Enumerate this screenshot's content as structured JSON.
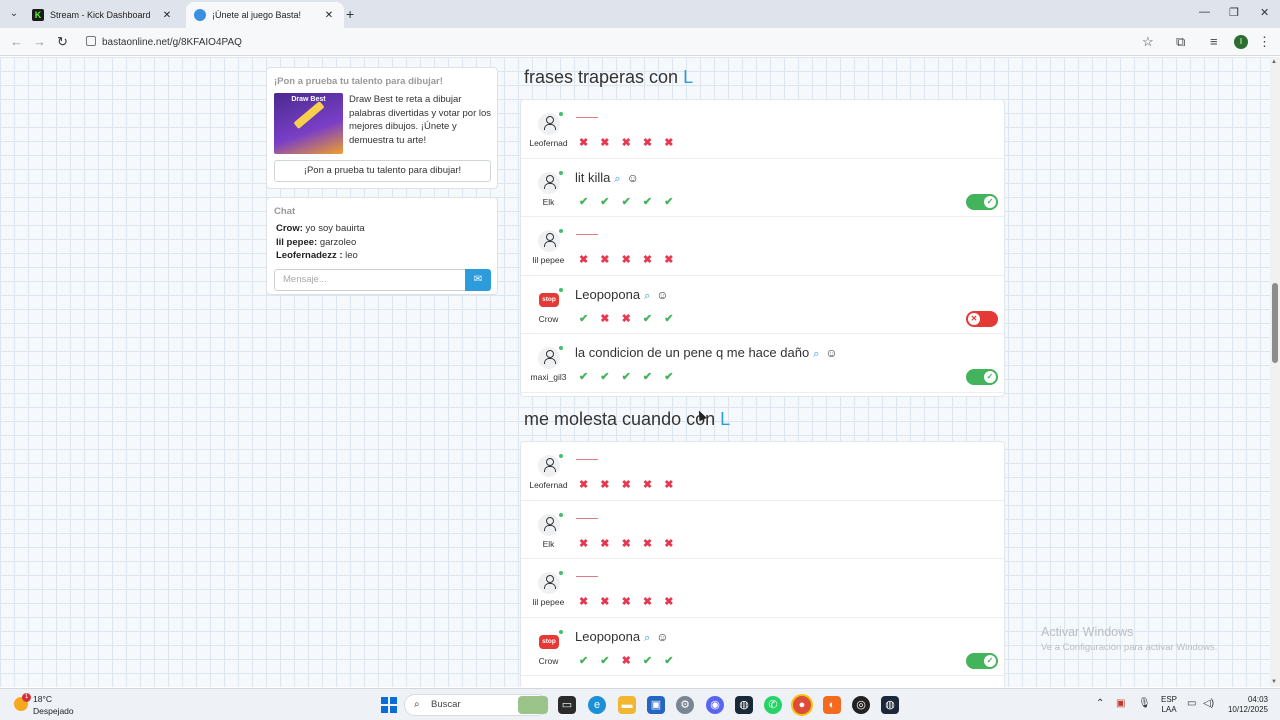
{
  "browser": {
    "tabs": [
      {
        "title": "Stream - Kick Dashboard",
        "active": false
      },
      {
        "title": "¡Únete al juego Basta!",
        "active": true
      }
    ],
    "url": "bastaonline.net/g/8KFAIO4PAQ",
    "profile_initial": "I"
  },
  "promo": {
    "heading": "¡Pon a prueba tu talento para dibujar!",
    "image_brand": "Draw Best",
    "text": "Draw Best te reta a dibujar palabras divertidas y votar por los mejores dibujos. ¡Únete y demuestra tu arte!",
    "button": "¡Pon a prueba tu talento para dibujar!"
  },
  "chat": {
    "heading": "Chat",
    "messages": [
      {
        "user": "Crow:",
        "text": " yo soy bauirta"
      },
      {
        "user": "lil pepee:",
        "text": " garzoleo"
      },
      {
        "user": "Leofernadezz :",
        "text": " leo"
      }
    ],
    "placeholder": "Mensaje..."
  },
  "categories": [
    {
      "title": "frases traperas con",
      "letter": "L",
      "rows": [
        {
          "user": "Leofernad",
          "avatar": "person",
          "answer": "",
          "votes": [
            "no",
            "no",
            "no",
            "no",
            "no"
          ],
          "toggle": null
        },
        {
          "user": "Elk",
          "avatar": "person",
          "answer": "lit killa",
          "votes": [
            "yes",
            "yes",
            "yes",
            "yes",
            "yes"
          ],
          "toggle": "on"
        },
        {
          "user": "lil pepee",
          "avatar": "person",
          "answer": "",
          "votes": [
            "no",
            "no",
            "no",
            "no",
            "no"
          ],
          "toggle": null
        },
        {
          "user": "Crow",
          "avatar": "stop",
          "answer": "Leopopona",
          "votes": [
            "yes",
            "no",
            "no",
            "yes",
            "yes"
          ],
          "toggle": "off"
        },
        {
          "user": "maxi_gil3",
          "avatar": "person",
          "answer": "la condicion de un pene q me hace daño",
          "votes": [
            "yes",
            "yes",
            "yes",
            "yes",
            "yes"
          ],
          "toggle": "on"
        }
      ]
    },
    {
      "title": "me molesta cuando con",
      "letter": "L",
      "rows": [
        {
          "user": "Leofernad",
          "avatar": "person",
          "answer": "",
          "votes": [
            "no",
            "no",
            "no",
            "no",
            "no"
          ],
          "toggle": null
        },
        {
          "user": "Elk",
          "avatar": "person",
          "answer": "",
          "votes": [
            "no",
            "no",
            "no",
            "no",
            "no"
          ],
          "toggle": null
        },
        {
          "user": "lil pepee",
          "avatar": "person",
          "answer": "",
          "votes": [
            "no",
            "no",
            "no",
            "no",
            "no"
          ],
          "toggle": null
        },
        {
          "user": "Crow",
          "avatar": "stop",
          "answer": "Leopopona",
          "votes": [
            "yes",
            "yes",
            "no",
            "yes",
            "yes"
          ],
          "toggle": "on"
        }
      ]
    }
  ],
  "stop_badge_text": "stop",
  "watermark": {
    "line1": "Activar Windows",
    "line2": "Ve a Configuración para activar Windows."
  },
  "taskbar": {
    "temperature": "18°C",
    "weather": "Despejado",
    "weather_badge": "1",
    "search_placeholder": "Buscar",
    "lang_top": "ESP",
    "lang_bottom": "LAA",
    "time": "04:03",
    "date": "10/12/2025"
  }
}
